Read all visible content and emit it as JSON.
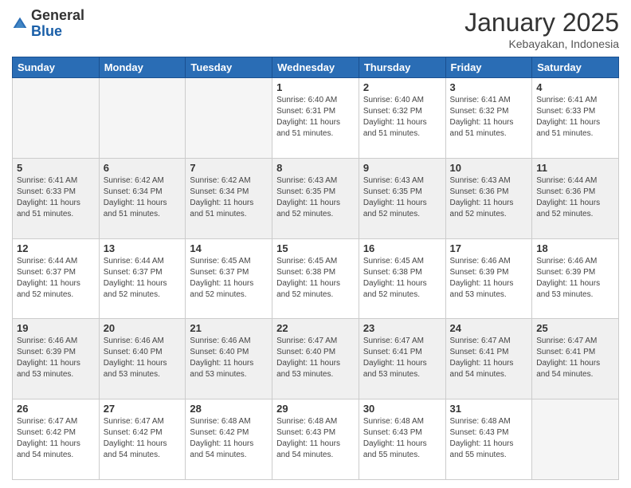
{
  "header": {
    "logo_general": "General",
    "logo_blue": "Blue",
    "month_title": "January 2025",
    "location": "Kebayakan, Indonesia"
  },
  "weekdays": [
    "Sunday",
    "Monday",
    "Tuesday",
    "Wednesday",
    "Thursday",
    "Friday",
    "Saturday"
  ],
  "weeks": [
    [
      {
        "day": "",
        "sunrise": "",
        "sunset": "",
        "daylight": "",
        "empty": true
      },
      {
        "day": "",
        "sunrise": "",
        "sunset": "",
        "daylight": "",
        "empty": true
      },
      {
        "day": "",
        "sunrise": "",
        "sunset": "",
        "daylight": "",
        "empty": true
      },
      {
        "day": "1",
        "sunrise": "Sunrise: 6:40 AM",
        "sunset": "Sunset: 6:31 PM",
        "daylight": "Daylight: 11 hours and 51 minutes.",
        "empty": false
      },
      {
        "day": "2",
        "sunrise": "Sunrise: 6:40 AM",
        "sunset": "Sunset: 6:32 PM",
        "daylight": "Daylight: 11 hours and 51 minutes.",
        "empty": false
      },
      {
        "day": "3",
        "sunrise": "Sunrise: 6:41 AM",
        "sunset": "Sunset: 6:32 PM",
        "daylight": "Daylight: 11 hours and 51 minutes.",
        "empty": false
      },
      {
        "day": "4",
        "sunrise": "Sunrise: 6:41 AM",
        "sunset": "Sunset: 6:33 PM",
        "daylight": "Daylight: 11 hours and 51 minutes.",
        "empty": false
      }
    ],
    [
      {
        "day": "5",
        "sunrise": "Sunrise: 6:41 AM",
        "sunset": "Sunset: 6:33 PM",
        "daylight": "Daylight: 11 hours and 51 minutes.",
        "empty": false
      },
      {
        "day": "6",
        "sunrise": "Sunrise: 6:42 AM",
        "sunset": "Sunset: 6:34 PM",
        "daylight": "Daylight: 11 hours and 51 minutes.",
        "empty": false
      },
      {
        "day": "7",
        "sunrise": "Sunrise: 6:42 AM",
        "sunset": "Sunset: 6:34 PM",
        "daylight": "Daylight: 11 hours and 51 minutes.",
        "empty": false
      },
      {
        "day": "8",
        "sunrise": "Sunrise: 6:43 AM",
        "sunset": "Sunset: 6:35 PM",
        "daylight": "Daylight: 11 hours and 52 minutes.",
        "empty": false
      },
      {
        "day": "9",
        "sunrise": "Sunrise: 6:43 AM",
        "sunset": "Sunset: 6:35 PM",
        "daylight": "Daylight: 11 hours and 52 minutes.",
        "empty": false
      },
      {
        "day": "10",
        "sunrise": "Sunrise: 6:43 AM",
        "sunset": "Sunset: 6:36 PM",
        "daylight": "Daylight: 11 hours and 52 minutes.",
        "empty": false
      },
      {
        "day": "11",
        "sunrise": "Sunrise: 6:44 AM",
        "sunset": "Sunset: 6:36 PM",
        "daylight": "Daylight: 11 hours and 52 minutes.",
        "empty": false
      }
    ],
    [
      {
        "day": "12",
        "sunrise": "Sunrise: 6:44 AM",
        "sunset": "Sunset: 6:37 PM",
        "daylight": "Daylight: 11 hours and 52 minutes.",
        "empty": false
      },
      {
        "day": "13",
        "sunrise": "Sunrise: 6:44 AM",
        "sunset": "Sunset: 6:37 PM",
        "daylight": "Daylight: 11 hours and 52 minutes.",
        "empty": false
      },
      {
        "day": "14",
        "sunrise": "Sunrise: 6:45 AM",
        "sunset": "Sunset: 6:37 PM",
        "daylight": "Daylight: 11 hours and 52 minutes.",
        "empty": false
      },
      {
        "day": "15",
        "sunrise": "Sunrise: 6:45 AM",
        "sunset": "Sunset: 6:38 PM",
        "daylight": "Daylight: 11 hours and 52 minutes.",
        "empty": false
      },
      {
        "day": "16",
        "sunrise": "Sunrise: 6:45 AM",
        "sunset": "Sunset: 6:38 PM",
        "daylight": "Daylight: 11 hours and 52 minutes.",
        "empty": false
      },
      {
        "day": "17",
        "sunrise": "Sunrise: 6:46 AM",
        "sunset": "Sunset: 6:39 PM",
        "daylight": "Daylight: 11 hours and 53 minutes.",
        "empty": false
      },
      {
        "day": "18",
        "sunrise": "Sunrise: 6:46 AM",
        "sunset": "Sunset: 6:39 PM",
        "daylight": "Daylight: 11 hours and 53 minutes.",
        "empty": false
      }
    ],
    [
      {
        "day": "19",
        "sunrise": "Sunrise: 6:46 AM",
        "sunset": "Sunset: 6:39 PM",
        "daylight": "Daylight: 11 hours and 53 minutes.",
        "empty": false
      },
      {
        "day": "20",
        "sunrise": "Sunrise: 6:46 AM",
        "sunset": "Sunset: 6:40 PM",
        "daylight": "Daylight: 11 hours and 53 minutes.",
        "empty": false
      },
      {
        "day": "21",
        "sunrise": "Sunrise: 6:46 AM",
        "sunset": "Sunset: 6:40 PM",
        "daylight": "Daylight: 11 hours and 53 minutes.",
        "empty": false
      },
      {
        "day": "22",
        "sunrise": "Sunrise: 6:47 AM",
        "sunset": "Sunset: 6:40 PM",
        "daylight": "Daylight: 11 hours and 53 minutes.",
        "empty": false
      },
      {
        "day": "23",
        "sunrise": "Sunrise: 6:47 AM",
        "sunset": "Sunset: 6:41 PM",
        "daylight": "Daylight: 11 hours and 53 minutes.",
        "empty": false
      },
      {
        "day": "24",
        "sunrise": "Sunrise: 6:47 AM",
        "sunset": "Sunset: 6:41 PM",
        "daylight": "Daylight: 11 hours and 54 minutes.",
        "empty": false
      },
      {
        "day": "25",
        "sunrise": "Sunrise: 6:47 AM",
        "sunset": "Sunset: 6:41 PM",
        "daylight": "Daylight: 11 hours and 54 minutes.",
        "empty": false
      }
    ],
    [
      {
        "day": "26",
        "sunrise": "Sunrise: 6:47 AM",
        "sunset": "Sunset: 6:42 PM",
        "daylight": "Daylight: 11 hours and 54 minutes.",
        "empty": false
      },
      {
        "day": "27",
        "sunrise": "Sunrise: 6:47 AM",
        "sunset": "Sunset: 6:42 PM",
        "daylight": "Daylight: 11 hours and 54 minutes.",
        "empty": false
      },
      {
        "day": "28",
        "sunrise": "Sunrise: 6:48 AM",
        "sunset": "Sunset: 6:42 PM",
        "daylight": "Daylight: 11 hours and 54 minutes.",
        "empty": false
      },
      {
        "day": "29",
        "sunrise": "Sunrise: 6:48 AM",
        "sunset": "Sunset: 6:43 PM",
        "daylight": "Daylight: 11 hours and 54 minutes.",
        "empty": false
      },
      {
        "day": "30",
        "sunrise": "Sunrise: 6:48 AM",
        "sunset": "Sunset: 6:43 PM",
        "daylight": "Daylight: 11 hours and 55 minutes.",
        "empty": false
      },
      {
        "day": "31",
        "sunrise": "Sunrise: 6:48 AM",
        "sunset": "Sunset: 6:43 PM",
        "daylight": "Daylight: 11 hours and 55 minutes.",
        "empty": false
      },
      {
        "day": "",
        "sunrise": "",
        "sunset": "",
        "daylight": "",
        "empty": true
      }
    ]
  ]
}
